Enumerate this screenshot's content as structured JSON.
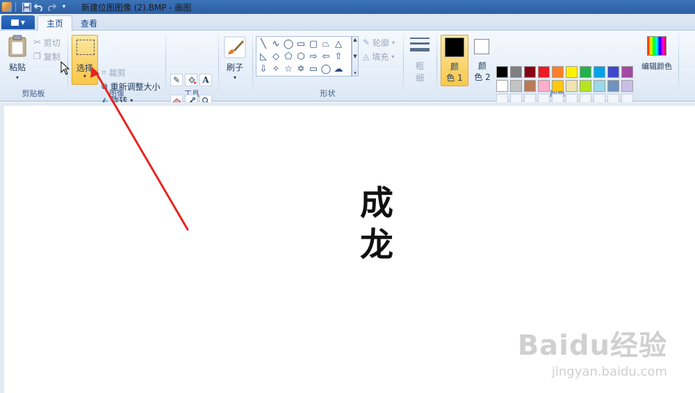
{
  "window": {
    "title": "新建位图图像 (2).BMP - 画图"
  },
  "tabs": {
    "home": "主页",
    "view": "查看"
  },
  "clipboard": {
    "paste": "粘贴",
    "cut": "剪切",
    "copy": "复制",
    "label": "剪贴板"
  },
  "image": {
    "select": "选择",
    "crop": "裁剪",
    "resize": "重新调整大小",
    "rotate": "旋转",
    "label": "图像"
  },
  "tools": {
    "label": "工具"
  },
  "brush": {
    "label": "刷子"
  },
  "shapes": {
    "outline": "轮廓",
    "fill": "填充",
    "label": "形状"
  },
  "size": {
    "line1": "粗",
    "line2": "细"
  },
  "colors": {
    "color1_line1": "颜",
    "color1_line2": "色 1",
    "color2_line1": "颜",
    "color2_line2": "色 2",
    "edit": "编辑颜色",
    "label": "颜色",
    "color1_value": "#000000",
    "color2_value": "#ffffff",
    "palette_row1": [
      "#000000",
      "#7f7f7f",
      "#880015",
      "#ed1c24",
      "#ff7f27",
      "#fff200",
      "#22b14c",
      "#00a2e8",
      "#3f48cc",
      "#a349a4"
    ],
    "palette_row2": [
      "#ffffff",
      "#c3c3c3",
      "#b97a57",
      "#ffaec9",
      "#ffc90e",
      "#efe4b0",
      "#b5e61d",
      "#99d9ea",
      "#7092be",
      "#c8bfe7"
    ]
  },
  "canvas": {
    "char1": "成",
    "char2": "龙"
  },
  "watermark": {
    "logo": "Baidu经验",
    "url": "jingyan.baidu.com"
  }
}
